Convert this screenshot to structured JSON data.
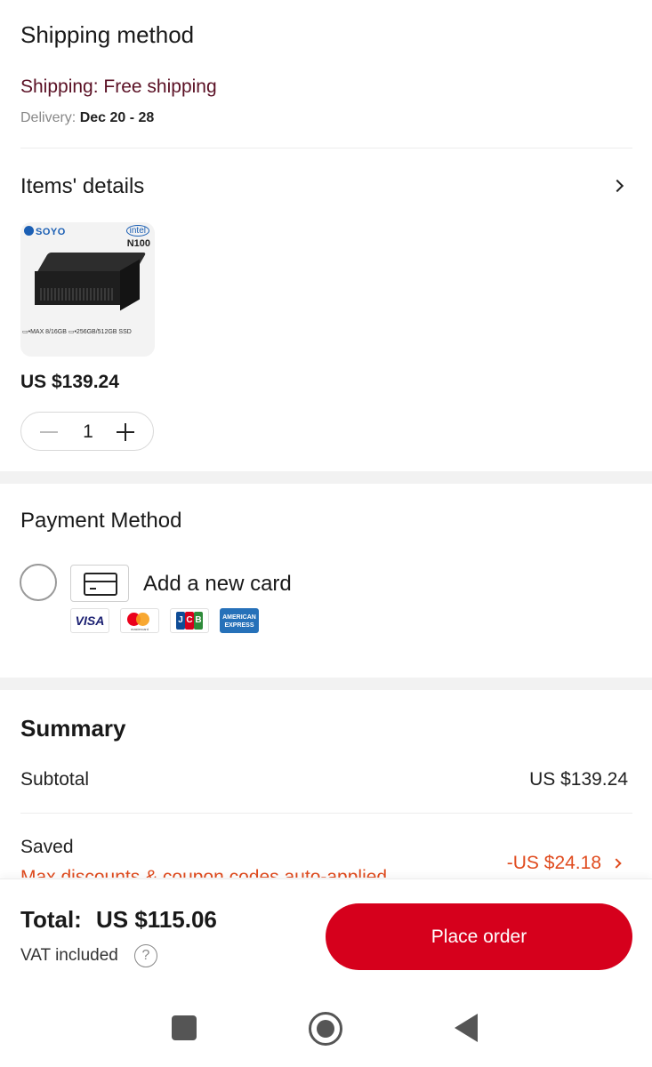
{
  "shipping": {
    "title": "Shipping method",
    "line": "Shipping: Free shipping",
    "delivery_label": "Delivery:",
    "delivery_dates": "Dec 20 - 28"
  },
  "items": {
    "title": "Items' details",
    "product": {
      "image_brand": "SOYO",
      "image_intel": "intel",
      "image_cpu": "N100",
      "image_spec": "▭•MAX 8/16GB ▭•256GB/512GB SSD",
      "price": "US $139.24",
      "quantity": "1"
    }
  },
  "payment": {
    "title": "Payment Method",
    "add_card": "Add a new card",
    "brands": {
      "visa": "VISA",
      "mastercard": "mastercard",
      "jcb": [
        "J",
        "C",
        "B"
      ],
      "amex_line1": "AMERICAN",
      "amex_line2": "EXPRESS"
    }
  },
  "summary": {
    "title": "Summary",
    "subtotal_label": "Subtotal",
    "subtotal_value": "US $139.24",
    "saved_label": "Saved",
    "saved_sub": "Max discounts & coupon codes auto-applied",
    "saved_value": "-US $24.18"
  },
  "footer": {
    "total_label": "Total:",
    "total_value": "US $115.06",
    "vat": "VAT included",
    "help": "?",
    "place_order": "Place order"
  },
  "colors": {
    "accent": "#d6001c",
    "discount": "#e04b1e",
    "shipping_text": "#5a1024"
  }
}
